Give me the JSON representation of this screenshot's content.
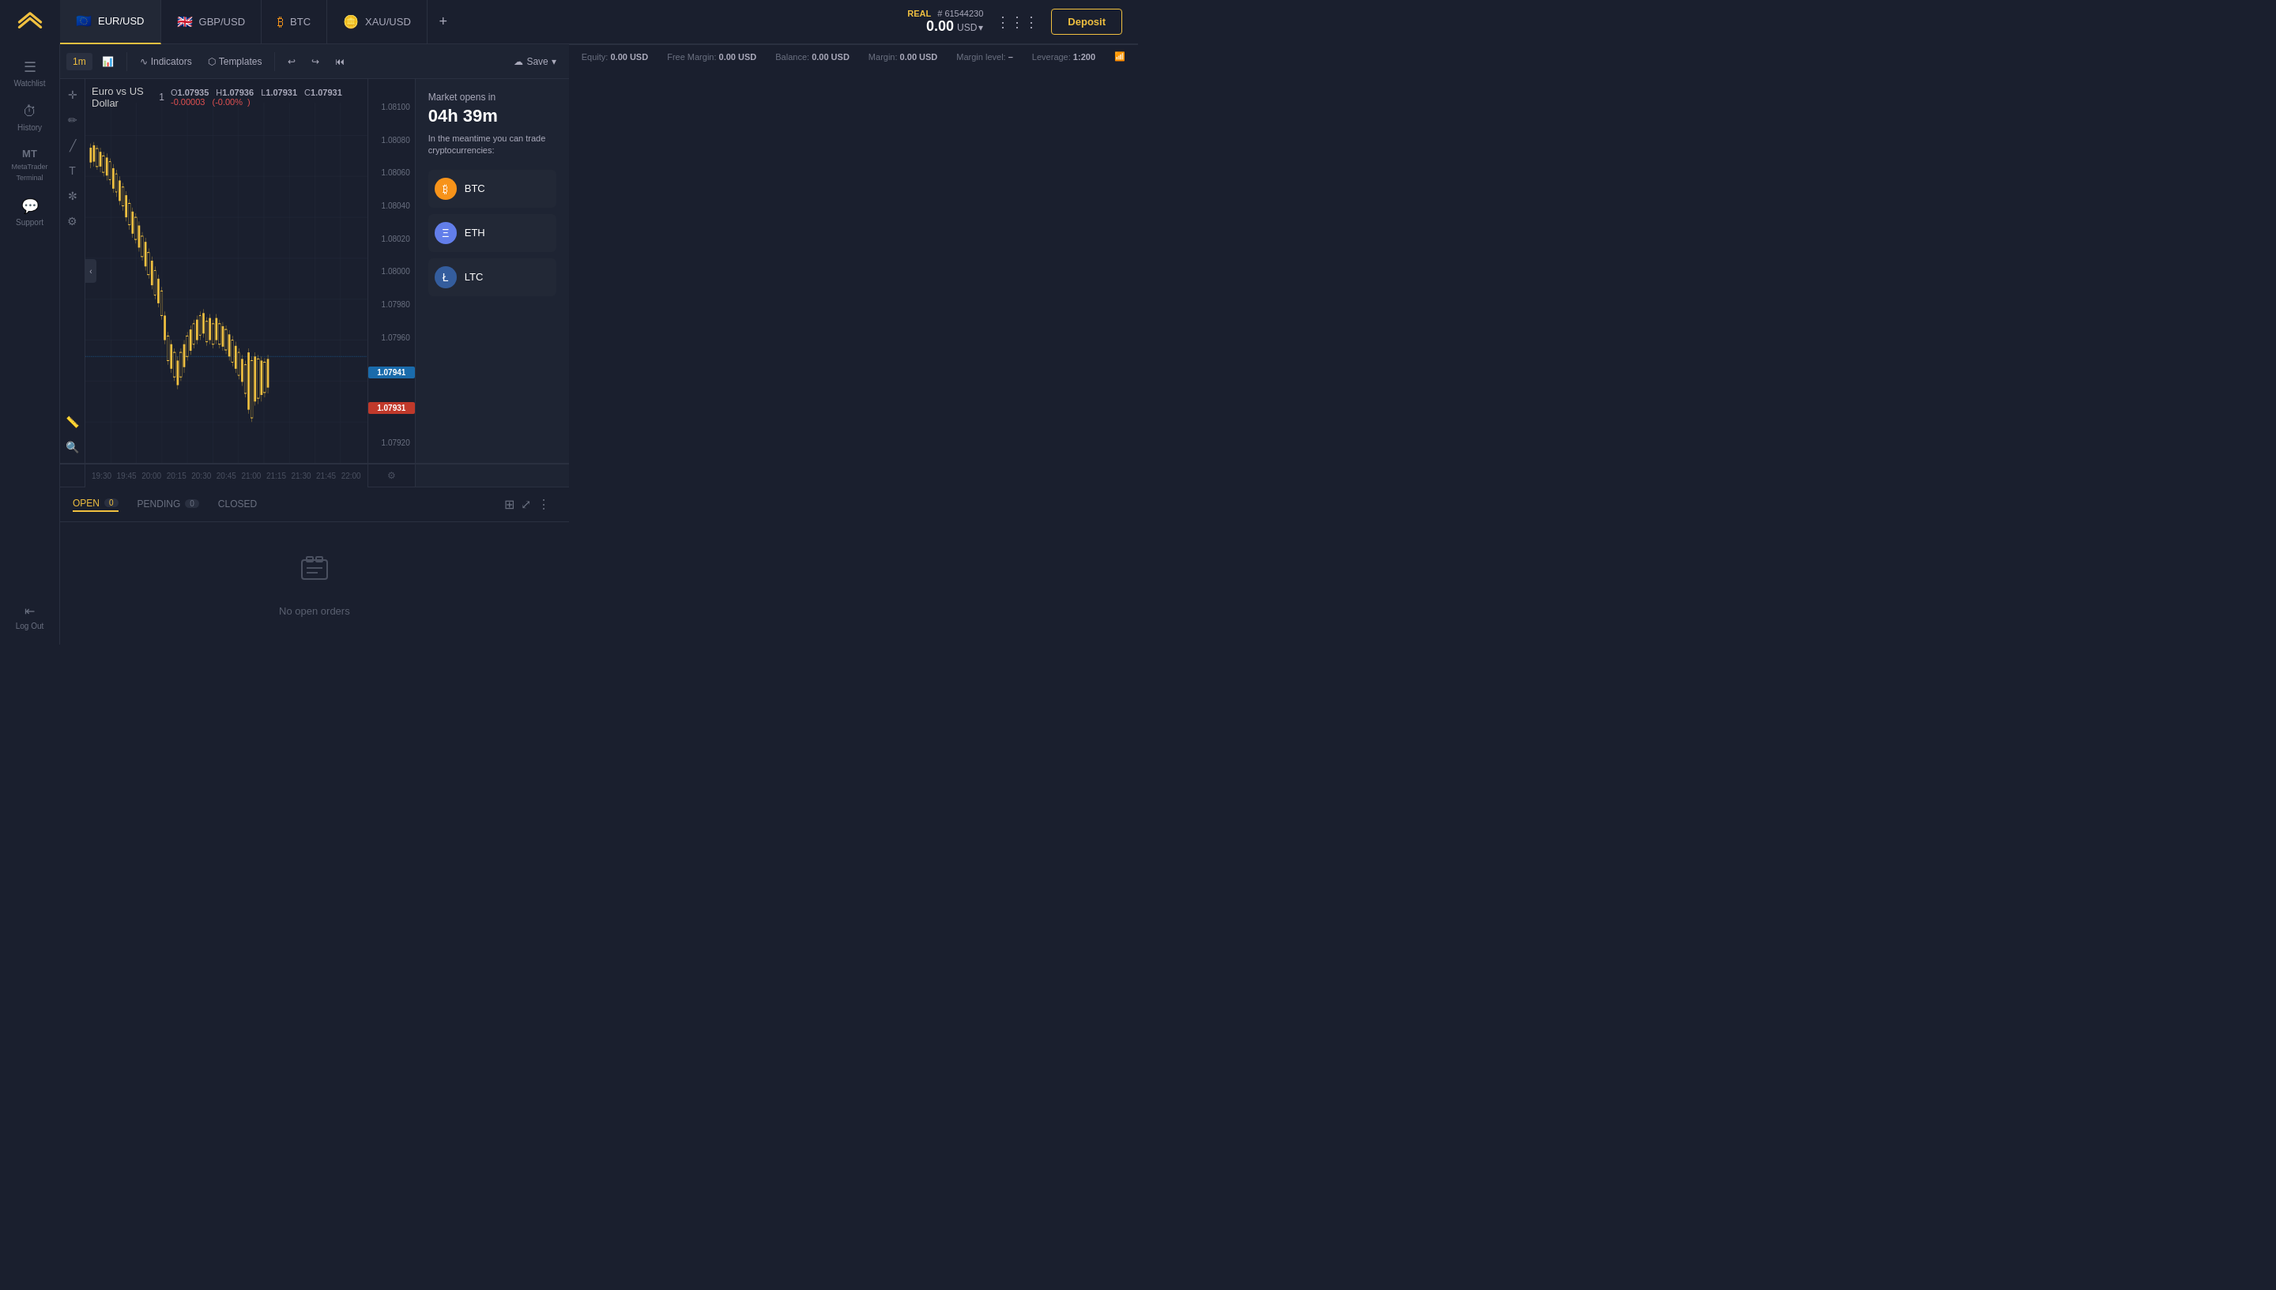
{
  "logo": {
    "alt": "Exness Logo"
  },
  "tabs": [
    {
      "id": "eur-usd",
      "label": "EUR/USD",
      "active": true,
      "flag": "EU"
    },
    {
      "id": "gbp-usd",
      "label": "GBP/USD",
      "active": false,
      "flag": "GB"
    },
    {
      "id": "btc",
      "label": "BTC",
      "active": false,
      "flag": "BTC"
    },
    {
      "id": "xau-usd",
      "label": "XAU/USD",
      "active": false,
      "flag": "XAU"
    }
  ],
  "add_tab_label": "+",
  "account": {
    "type": "REAL",
    "number": "# 61544230",
    "balance": "0.00",
    "currency": "USD"
  },
  "deposit_label": "Deposit",
  "sidebar": {
    "items": [
      {
        "id": "watchlist",
        "icon": "☰",
        "label": "Watchlist"
      },
      {
        "id": "history",
        "icon": "⏱",
        "label": "History"
      },
      {
        "id": "metatrader",
        "icon": "MT",
        "label": "MetaTrader Terminal"
      },
      {
        "id": "support",
        "icon": "💬",
        "label": "Support"
      }
    ],
    "bottom": [
      {
        "id": "logout",
        "icon": "⇤",
        "label": "Log Out"
      }
    ]
  },
  "toolbar": {
    "timeframe": "1m",
    "indicators_label": "Indicators",
    "templates_label": "Templates",
    "save_label": "Save"
  },
  "chart": {
    "symbol": "Euro vs US Dollar",
    "tf": "1",
    "O": "1.07935",
    "H": "1.07936",
    "L": "1.07931",
    "C": "1.07931",
    "change": "-0.00003",
    "change_pct": "-0.00%",
    "price_labels": [
      "1.08100",
      "1.08080",
      "1.08060",
      "1.08040",
      "1.08020",
      "1.08000",
      "1.07980",
      "1.07960",
      "1.07941",
      "1.07931",
      "1.07920"
    ],
    "current_price_blue": "1.07941",
    "current_price_red": "1.07931",
    "time_labels": [
      "19:30",
      "19:45",
      "20:00",
      "20:15",
      "20:30",
      "20:45",
      "21:00",
      "21:15",
      "21:30",
      "21:45",
      "22:00"
    ]
  },
  "right_panel": {
    "market_opens_label": "Market opens in",
    "market_time": "04h 39m",
    "market_note": "In the meantime you can trade cryptocurrencies:",
    "cryptos": [
      {
        "id": "btc",
        "name": "BTC",
        "class": "btc",
        "icon": "₿"
      },
      {
        "id": "eth",
        "name": "ETH",
        "class": "eth",
        "icon": "Ξ"
      },
      {
        "id": "ltc",
        "name": "LTC",
        "class": "ltc",
        "icon": "Ł"
      }
    ]
  },
  "orders": {
    "tabs": [
      {
        "id": "open",
        "label": "OPEN",
        "count": "0",
        "active": true
      },
      {
        "id": "pending",
        "label": "PENDING",
        "count": "0",
        "active": false
      },
      {
        "id": "closed",
        "label": "CLOSED",
        "count": null,
        "active": false
      }
    ],
    "empty_label": "No open orders"
  },
  "status_bar": {
    "equity_label": "Equity:",
    "equity_value": "0.00 USD",
    "free_margin_label": "Free Margin:",
    "free_margin_value": "0.00 USD",
    "balance_label": "Balance:",
    "balance_value": "0.00 USD",
    "margin_label": "Margin:",
    "margin_value": "0.00 USD",
    "margin_level_label": "Margin level:",
    "margin_level_value": "–",
    "leverage_label": "Leverage:",
    "leverage_value": "1:200"
  }
}
